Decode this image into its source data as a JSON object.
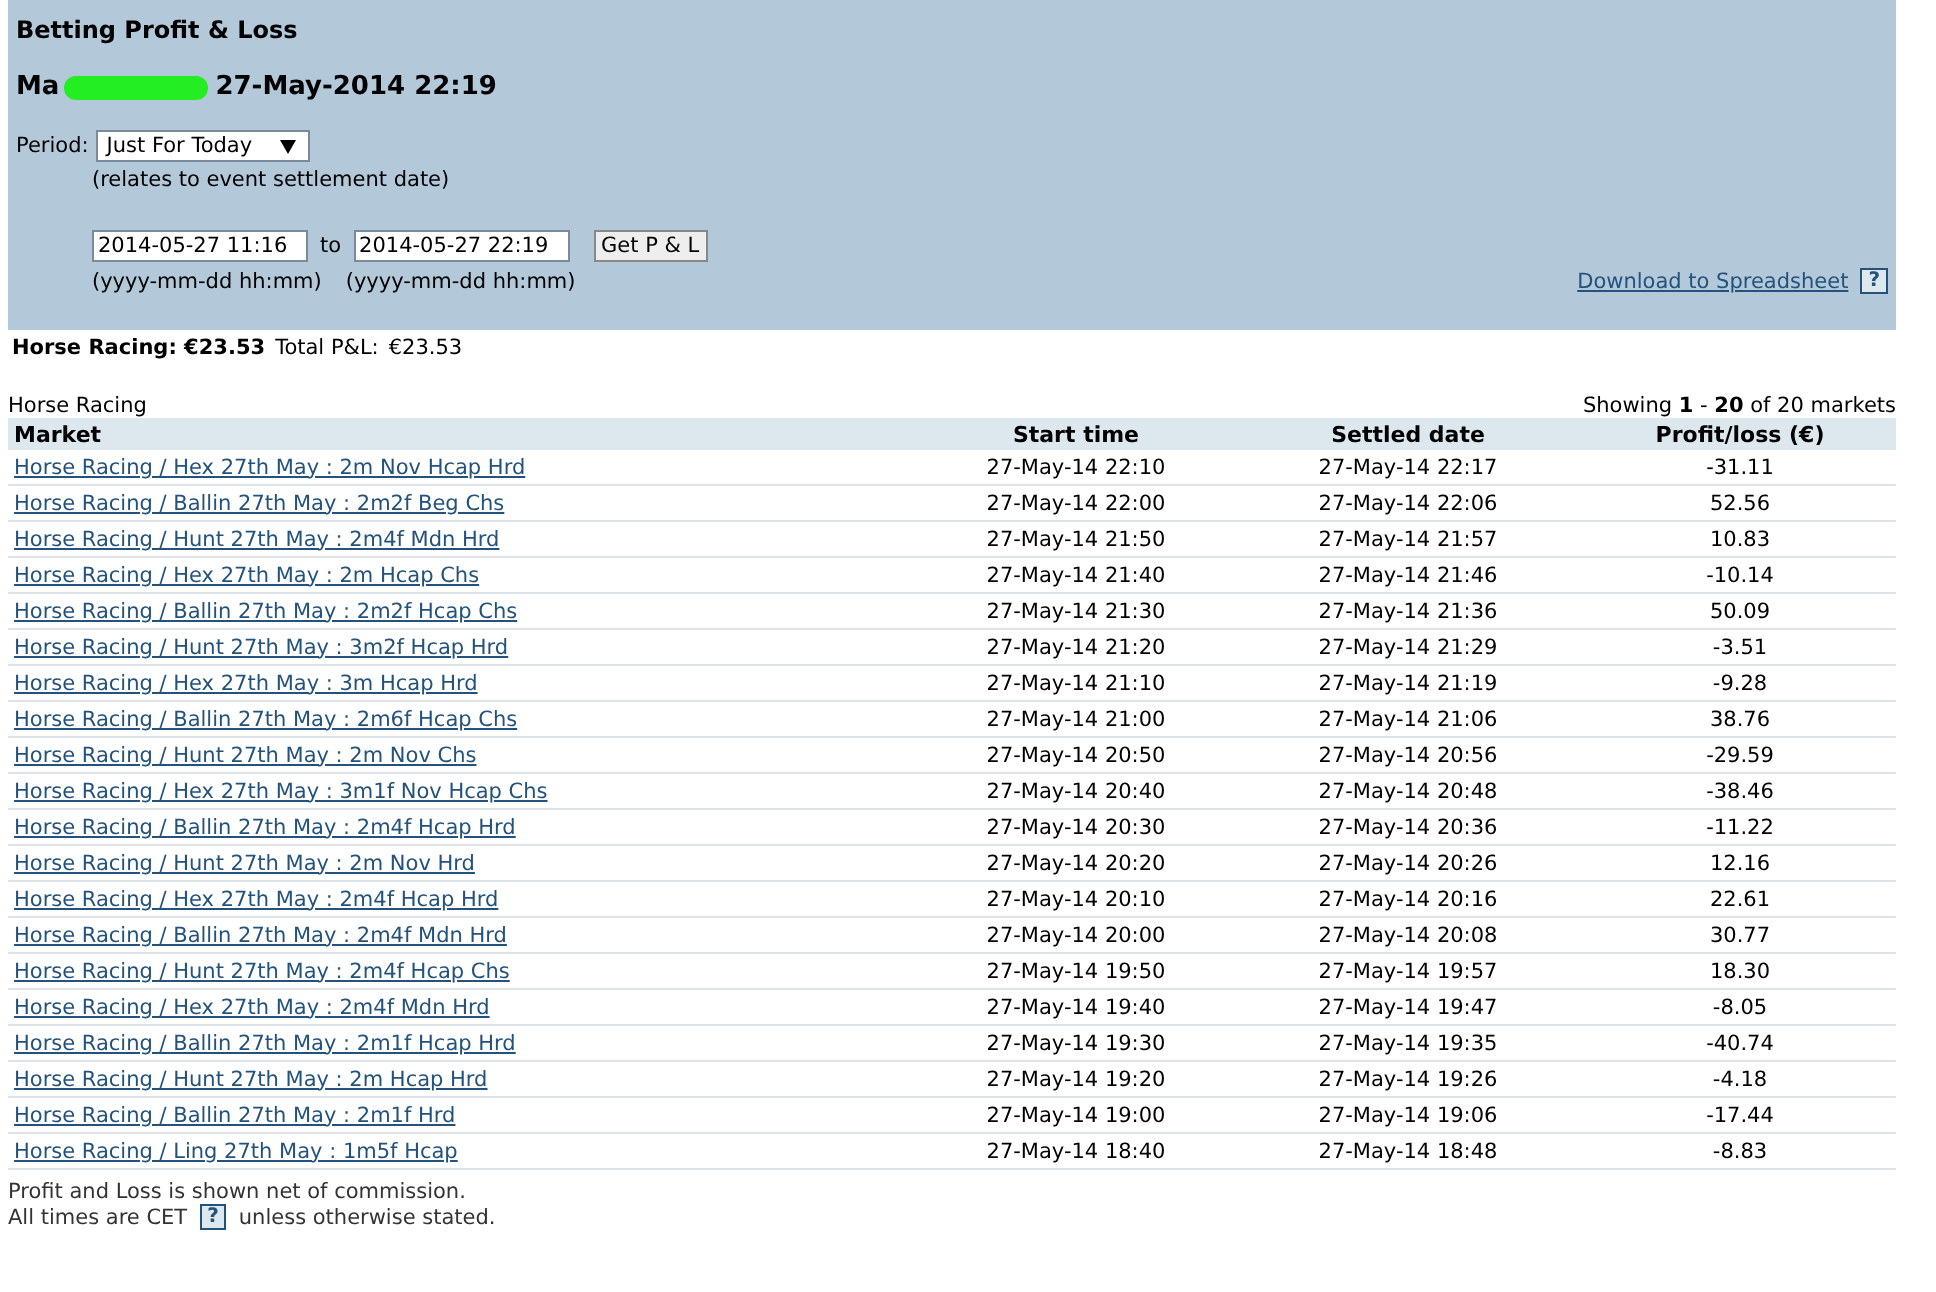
{
  "header": {
    "title": "Betting Profit & Loss",
    "account_prefix": "Ma",
    "account_redacted": true,
    "timestamp": "27-May-2014 22:19"
  },
  "filters": {
    "period_label": "Period:",
    "period_value": "Just For Today",
    "period_note": "(relates to event settlement date)",
    "from_value": "2014-05-27 11:16",
    "to_label": "to",
    "to_value": "2014-05-27 22:19",
    "button": "Get P & L",
    "from_hint": "(yyyy-mm-dd hh:mm)",
    "to_hint": "(yyyy-mm-dd hh:mm)",
    "download_link": "Download to Spreadsheet",
    "help": "?"
  },
  "summary": {
    "sport_total": "Horse Racing: €23.53",
    "total_label": "Total P&L:",
    "total_value": "€23.53"
  },
  "table": {
    "caption": "Horse Racing",
    "showing": "Showing **1** - **20** of 20 markets",
    "columns": [
      "Market",
      "Start time",
      "Settled date",
      "Profit/loss (€)"
    ],
    "rows": [
      [
        "Horse Racing / Hex 27th May : 2m Nov Hcap Hrd",
        "27-May-14 22:10",
        "27-May-14 22:17",
        "-31.11"
      ],
      [
        "Horse Racing / Ballin 27th May : 2m2f Beg Chs",
        "27-May-14 22:00",
        "27-May-14 22:06",
        "52.56"
      ],
      [
        "Horse Racing / Hunt 27th May : 2m4f Mdn Hrd",
        "27-May-14 21:50",
        "27-May-14 21:57",
        "10.83"
      ],
      [
        "Horse Racing / Hex 27th May : 2m Hcap Chs",
        "27-May-14 21:40",
        "27-May-14 21:46",
        "-10.14"
      ],
      [
        "Horse Racing / Ballin 27th May : 2m2f Hcap Chs",
        "27-May-14 21:30",
        "27-May-14 21:36",
        "50.09"
      ],
      [
        "Horse Racing / Hunt 27th May : 3m2f Hcap Hrd",
        "27-May-14 21:20",
        "27-May-14 21:29",
        "-3.51"
      ],
      [
        "Horse Racing / Hex 27th May : 3m Hcap Hrd",
        "27-May-14 21:10",
        "27-May-14 21:19",
        "-9.28"
      ],
      [
        "Horse Racing / Ballin 27th May : 2m6f Hcap Chs",
        "27-May-14 21:00",
        "27-May-14 21:06",
        "38.76"
      ],
      [
        "Horse Racing / Hunt 27th May : 2m Nov Chs",
        "27-May-14 20:50",
        "27-May-14 20:56",
        "-29.59"
      ],
      [
        "Horse Racing / Hex 27th May : 3m1f Nov Hcap Chs",
        "27-May-14 20:40",
        "27-May-14 20:48",
        "-38.46"
      ],
      [
        "Horse Racing / Ballin 27th May : 2m4f Hcap Hrd",
        "27-May-14 20:30",
        "27-May-14 20:36",
        "-11.22"
      ],
      [
        "Horse Racing / Hunt 27th May : 2m Nov Hrd",
        "27-May-14 20:20",
        "27-May-14 20:26",
        "12.16"
      ],
      [
        "Horse Racing / Hex 27th May : 2m4f Hcap Hrd",
        "27-May-14 20:10",
        "27-May-14 20:16",
        "22.61"
      ],
      [
        "Horse Racing / Ballin 27th May : 2m4f Mdn Hrd",
        "27-May-14 20:00",
        "27-May-14 20:08",
        "30.77"
      ],
      [
        "Horse Racing / Hunt 27th May : 2m4f Hcap Chs",
        "27-May-14 19:50",
        "27-May-14 19:57",
        "18.30"
      ],
      [
        "Horse Racing / Hex 27th May : 2m4f Mdn Hrd",
        "27-May-14 19:40",
        "27-May-14 19:47",
        "-8.05"
      ],
      [
        "Horse Racing / Ballin 27th May : 2m1f Hcap Hrd",
        "27-May-14 19:30",
        "27-May-14 19:35",
        "-40.74"
      ],
      [
        "Horse Racing / Hunt 27th May : 2m Hcap Hrd",
        "27-May-14 19:20",
        "27-May-14 19:26",
        "-4.18"
      ],
      [
        "Horse Racing / Ballin 27th May : 2m1f Hrd",
        "27-May-14 19:00",
        "27-May-14 19:06",
        "-17.44"
      ],
      [
        "Horse Racing / Ling 27th May : 1m5f Hcap",
        "27-May-14 18:40",
        "27-May-14 18:48",
        "-8.83"
      ]
    ]
  },
  "footer": {
    "commission_note": "Profit and Loss is shown net of commission.",
    "times_prefix": "All times are CET",
    "help": "?",
    "times_suffix": "unless otherwise stated."
  }
}
